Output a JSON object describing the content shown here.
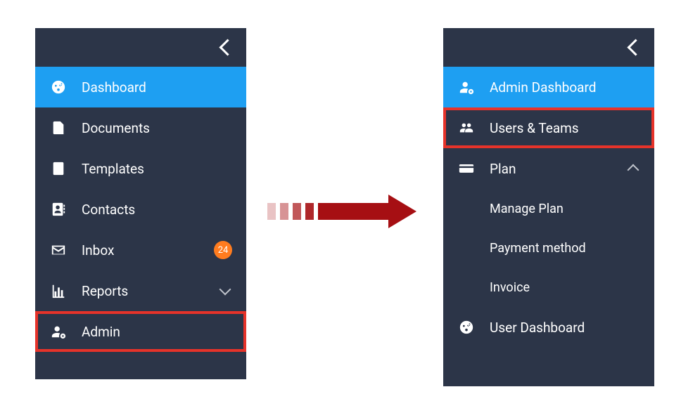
{
  "leftSidebar": {
    "items": [
      {
        "icon": "dashboard",
        "label": "Dashboard",
        "active": true
      },
      {
        "icon": "document",
        "label": "Documents"
      },
      {
        "icon": "template",
        "label": "Templates"
      },
      {
        "icon": "contacts",
        "label": "Contacts"
      },
      {
        "icon": "inbox",
        "label": "Inbox",
        "badge": "24"
      },
      {
        "icon": "reports",
        "label": "Reports",
        "expand": "down"
      },
      {
        "icon": "admin",
        "label": "Admin",
        "highlighted": true
      }
    ]
  },
  "rightSidebar": {
    "items": [
      {
        "icon": "admin",
        "label": "Admin Dashboard",
        "active": true
      },
      {
        "icon": "users",
        "label": "Users & Teams",
        "highlighted": true
      },
      {
        "icon": "plan",
        "label": "Plan",
        "expand": "up"
      }
    ],
    "subitems": [
      {
        "label": "Manage Plan"
      },
      {
        "label": "Payment method"
      },
      {
        "label": "Invoice"
      }
    ],
    "footerItem": {
      "icon": "dashboard",
      "label": "User Dashboard"
    }
  }
}
